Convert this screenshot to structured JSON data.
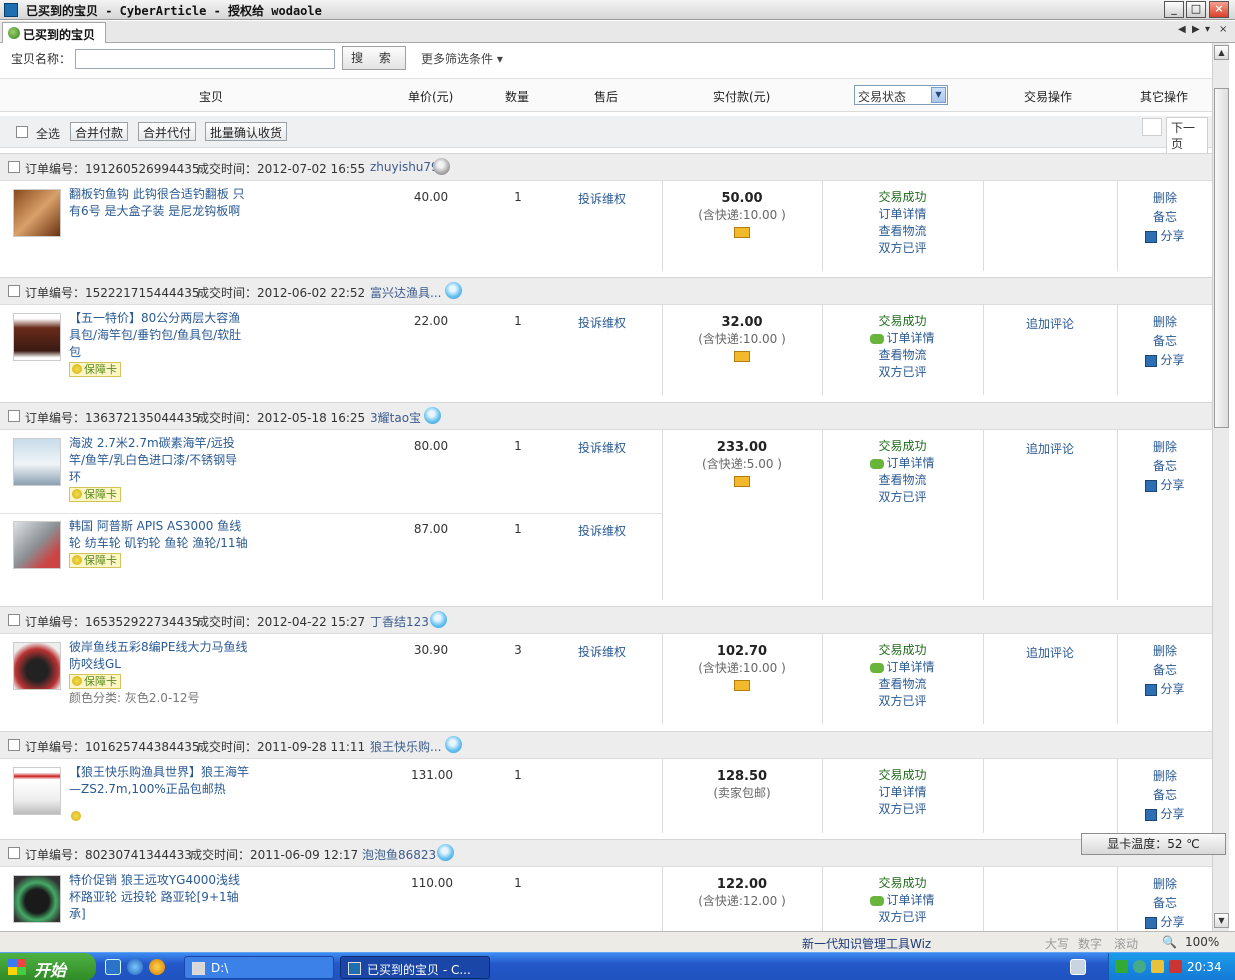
{
  "window": {
    "title": "已买到的宝贝 - CyberArticle - 授权给 wodaole",
    "minimize": "_",
    "maximize": "□",
    "close": "×"
  },
  "tab": {
    "label": "已买到的宝贝",
    "nav": [
      "◀",
      "▶",
      "▾",
      "×"
    ]
  },
  "search": {
    "label": "宝贝名称：",
    "value": "",
    "button": "搜 索",
    "more": "更多筛选条件 ▾"
  },
  "columns": {
    "item": "宝贝",
    "price": "单价(元)",
    "qty": "数量",
    "aftersale": "售后",
    "paid": "实付款(元)",
    "status_select": "交易状态",
    "ops": "交易操作",
    "other": "其它操作"
  },
  "toolbar": {
    "select_all": "全选",
    "merge_pay": "合并付款",
    "merge_proxy": "合并代付",
    "batch_confirm": "批量确认收货",
    "next_page": "下一页"
  },
  "orders": [
    {
      "no": "订单编号：191260526994435",
      "time": "成交时间：2012-07-02 16:55",
      "seller": "zhuyishu79",
      "online": false,
      "items": [
        {
          "name": "翻板钓鱼钩 此钩很合适钓翻板 只有6号 是大盒子装 是尼龙钩板啊",
          "badge": "",
          "extra": "",
          "price": "40.00",
          "qty": "1",
          "after": "投诉维权"
        }
      ],
      "amount": "50.00",
      "ship": "(含快递:10.00 )",
      "status": [
        "交易成功",
        "订单详情",
        "查看物流",
        "双方已评"
      ],
      "chat": false,
      "op": "",
      "other": [
        "删除",
        "备忘",
        "分享"
      ]
    },
    {
      "no": "订单编号：152221715444435",
      "time": "成交时间：2012-06-02 22:52",
      "seller": "富兴达渔具...",
      "online": true,
      "items": [
        {
          "name": "【五一特价】80公分两层大容渔具包/海竿包/垂钓包/鱼具包/软肚包",
          "badge": "保障卡",
          "extra": "",
          "price": "22.00",
          "qty": "1",
          "after": "投诉维权"
        }
      ],
      "amount": "32.00",
      "ship": "(含快递:10.00 )",
      "status": [
        "交易成功",
        "订单详情",
        "查看物流",
        "双方已评"
      ],
      "chat": true,
      "op": "追加评论",
      "other": [
        "删除",
        "备忘",
        "分享"
      ]
    },
    {
      "no": "订单编号：136372135044435",
      "time": "成交时间：2012-05-18 16:25",
      "seller": "3耀tao宝",
      "online": true,
      "items": [
        {
          "name": "海波 2.7米2.7m碳素海竿/远投竿/鱼竿/乳白色进口漆/不锈钢导环",
          "badge": "保障卡",
          "extra": "",
          "price": "80.00",
          "qty": "1",
          "after": "投诉维权"
        },
        {
          "name": "韩国 阿普斯 APIS AS3000 鱼线轮 纺车轮 矶钓轮 鱼轮 渔轮/11轴",
          "badge": "保障卡",
          "extra": "",
          "price": "87.00",
          "qty": "1",
          "after": "投诉维权"
        }
      ],
      "amount": "233.00",
      "ship": "(含快递:5.00 )",
      "status": [
        "交易成功",
        "订单详情",
        "查看物流",
        "双方已评"
      ],
      "chat": true,
      "op": "追加评论",
      "other": [
        "删除",
        "备忘",
        "分享"
      ]
    },
    {
      "no": "订单编号：165352922734435",
      "time": "成交时间：2012-04-22 15:27",
      "seller": "丁香结123",
      "online": true,
      "items": [
        {
          "name": "彼岸鱼线五彩8编PE线大力马鱼线防咬线GL",
          "badge": "保障卡",
          "extra": "颜色分类: 灰色2.0-12号",
          "price": "30.90",
          "qty": "3",
          "after": "投诉维权"
        }
      ],
      "amount": "102.70",
      "ship": "(含快递:10.00 )",
      "status": [
        "交易成功",
        "订单详情",
        "查看物流",
        "双方已评"
      ],
      "chat": true,
      "op": "追加评论",
      "other": [
        "删除",
        "备忘",
        "分享"
      ]
    },
    {
      "no": "订单编号：101625744384435",
      "time": "成交时间：2011-09-28 11:11",
      "seller": "狼王快乐购...",
      "online": true,
      "items": [
        {
          "name": "【狼王快乐购渔具世界】狼王海竿—ZS2.7m,100%正品包邮热",
          "badge": "",
          "extra": "",
          "price": "131.00",
          "qty": "1",
          "after": ""
        }
      ],
      "amount": "128.50",
      "ship": "(卖家包邮)",
      "status": [
        "交易成功",
        "订单详情",
        "双方已评"
      ],
      "chat": false,
      "op": "",
      "other": [
        "删除",
        "备忘",
        "分享"
      ]
    },
    {
      "no": "订单编号：80230741344433",
      "time": "成交时间：2011-06-09 12:17",
      "seller": "泡泡鱼86823",
      "online": true,
      "items": [
        {
          "name": "特价促销 狼王远攻YG4000浅线杯路亚轮 远投轮 路亚轮[9+1轴承]",
          "badge": "",
          "extra": "",
          "price": "110.00",
          "qty": "1",
          "after": ""
        }
      ],
      "amount": "122.00",
      "ship": "(含快递:12.00 )",
      "status": [
        "交易成功",
        "订单详情",
        "双方已评"
      ],
      "chat": true,
      "op": "",
      "other": [
        "删除",
        "备忘",
        "分享"
      ]
    }
  ],
  "gpu_temp": "显卡温度：52 ℃",
  "statusbar": {
    "product": "新一代知识管理工具Wiz",
    "caps": "大写",
    "num": "数字",
    "scroll": "滚动",
    "zoom": "100%"
  },
  "taskbar": {
    "start": "开始",
    "tasks": [
      "D:\\",
      "已买到的宝贝 - C..."
    ],
    "clock": "20:34"
  }
}
